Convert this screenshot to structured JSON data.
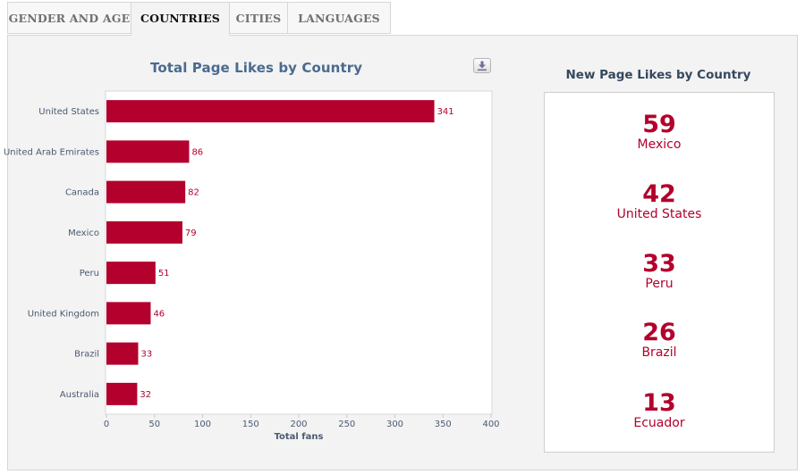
{
  "tabs": [
    {
      "label": "GENDER AND AGE",
      "active": false
    },
    {
      "label": "COUNTRIES",
      "active": true
    },
    {
      "label": "CITIES",
      "active": false
    },
    {
      "label": "LANGUAGES",
      "active": false
    }
  ],
  "left_panel": {
    "title": "Total Page Likes by Country",
    "download_icon": "download-icon"
  },
  "right_panel": {
    "title": "New Page Likes by Country",
    "stats": [
      {
        "value": "59",
        "country": "Mexico"
      },
      {
        "value": "42",
        "country": "United States"
      },
      {
        "value": "33",
        "country": "Peru"
      },
      {
        "value": "26",
        "country": "Brazil"
      },
      {
        "value": "13",
        "country": "Ecuador"
      }
    ]
  },
  "colors": {
    "bar": "#b3002c",
    "accent_text": "#b3002c",
    "title_blue": "#4b6a8f",
    "axis_text": "#4a5a70"
  },
  "chart_data": {
    "type": "bar",
    "orientation": "horizontal",
    "title": "Total Page Likes by Country",
    "categories": [
      "United States",
      "United Arab Emirates",
      "Canada",
      "Mexico",
      "Peru",
      "United Kingdom",
      "Brazil",
      "Australia"
    ],
    "values": [
      341,
      86,
      82,
      79,
      51,
      46,
      33,
      32
    ],
    "xlabel": "Total fans",
    "ylabel": "",
    "xlim": [
      0,
      400
    ],
    "xticks": [
      0,
      50,
      100,
      150,
      200,
      250,
      300,
      350,
      400
    ],
    "grid": false,
    "data_labels": true
  }
}
